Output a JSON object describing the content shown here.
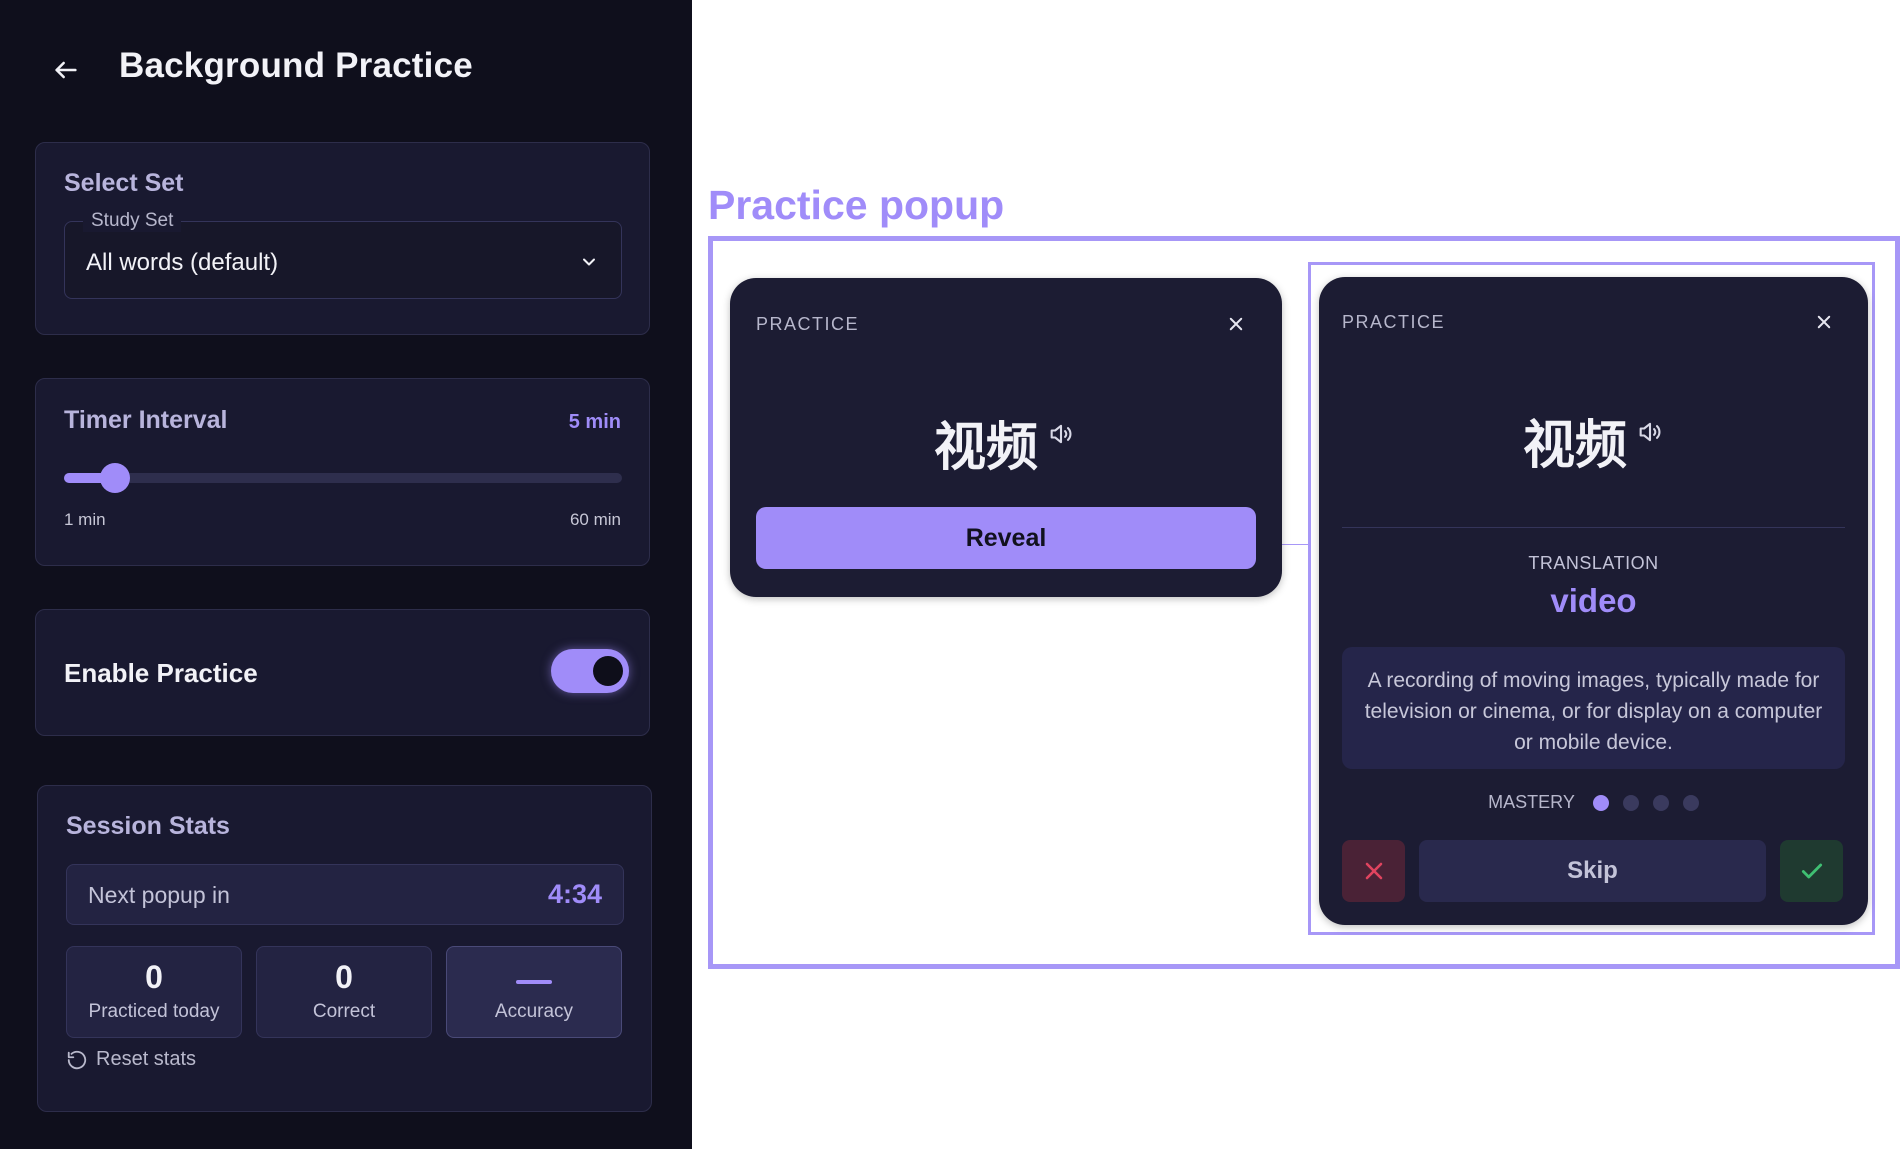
{
  "header": {
    "title": "Background Practice"
  },
  "select_set": {
    "title": "Select Set",
    "field_label": "Study Set",
    "value": "All words (default)"
  },
  "timer": {
    "title": "Timer Interval",
    "value_label": "5 min",
    "min_label": "1 min",
    "max_label": "60 min",
    "min": 1,
    "max": 60,
    "value": 5
  },
  "enable": {
    "label": "Enable Practice",
    "on": true
  },
  "stats": {
    "title": "Session Stats",
    "next_popup_label": "Next popup in",
    "next_popup_value": "4:34",
    "items": [
      {
        "value": "0",
        "label": "Practiced today"
      },
      {
        "value": "0",
        "label": "Correct"
      },
      {
        "value": "—",
        "label": "Accuracy"
      }
    ],
    "reset_label": "Reset stats"
  },
  "preview": {
    "title": "Practice popup",
    "question_popup": {
      "title": "PRACTICE",
      "word": "视频",
      "reveal_label": "Reveal"
    },
    "answer_popup": {
      "title": "PRACTICE",
      "word": "视频",
      "translation_label": "TRANSLATION",
      "translation": "video",
      "description": "A recording of moving images, typically made for television or cinema, or for display on a computer or mobile device.",
      "mastery_label": "MASTERY",
      "mastery_level": 1,
      "mastery_max": 4,
      "skip_label": "Skip"
    }
  },
  "colors": {
    "accent": "#a08cf9",
    "background": "#0f0f1c",
    "card": "#191930",
    "wrong": "#e0445f",
    "correct": "#3fbf72"
  }
}
